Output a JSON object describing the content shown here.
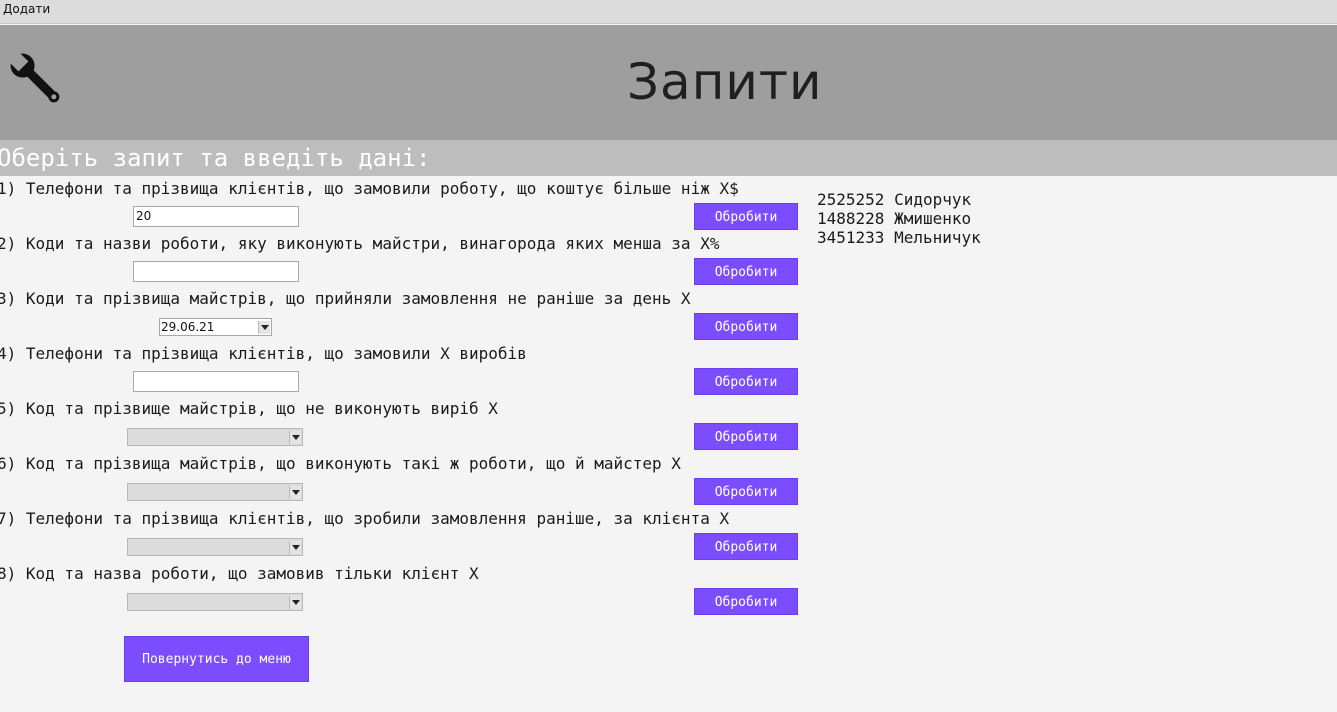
{
  "menu": {
    "add_label": "Додати"
  },
  "header": {
    "title": "Запити",
    "icon": "wrench-icon"
  },
  "subheader": {
    "text": "Оберіть запит та введіть дані:"
  },
  "queries": [
    {
      "label": "1) Телефони та прізвища клієнтів, що замовили роботу, що коштує більше ніж X$",
      "input_type": "text",
      "value": "20",
      "button": "Обробити"
    },
    {
      "label": "2) Коди та назви роботи, яку виконують майстри, винагорода яких менша за X%",
      "input_type": "text",
      "value": "",
      "button": "Обробити"
    },
    {
      "label": "3) Коди та прізвища майстрів, що прийняли замовлення не раніше за день X",
      "input_type": "date",
      "value": "29.06.21",
      "button": "Обробити"
    },
    {
      "label": "4) Телефони та прізвища клієнтів, що замовили X виробів",
      "input_type": "text",
      "value": "",
      "button": "Обробити"
    },
    {
      "label": "5) Код та прізвище майстрів, що не виконують виріб X",
      "input_type": "combo",
      "value": "",
      "button": "Обробити"
    },
    {
      "label": "6) Код та прізвища майстрів, що виконують такі ж роботи, що й майстер X",
      "input_type": "combo",
      "value": "",
      "button": "Обробити"
    },
    {
      "label": "7) Телефони та прізвища клієнтів, що зробили замовлення раніше, за клієнта X",
      "input_type": "combo",
      "value": "",
      "button": "Обробити"
    },
    {
      "label": "8) Код та назва роботи, що замовив тільки клієнт X",
      "input_type": "combo",
      "value": "",
      "button": "Обробити"
    }
  ],
  "results": [
    "2525252 Сидорчук",
    "1488228 Жмишенко",
    "3451233 Мельничук"
  ],
  "back_button": "Повернутись до меню",
  "colors": {
    "accent": "#7c4dff",
    "header_bg": "#9e9e9e",
    "subheader_bg": "#bdbdbd"
  }
}
